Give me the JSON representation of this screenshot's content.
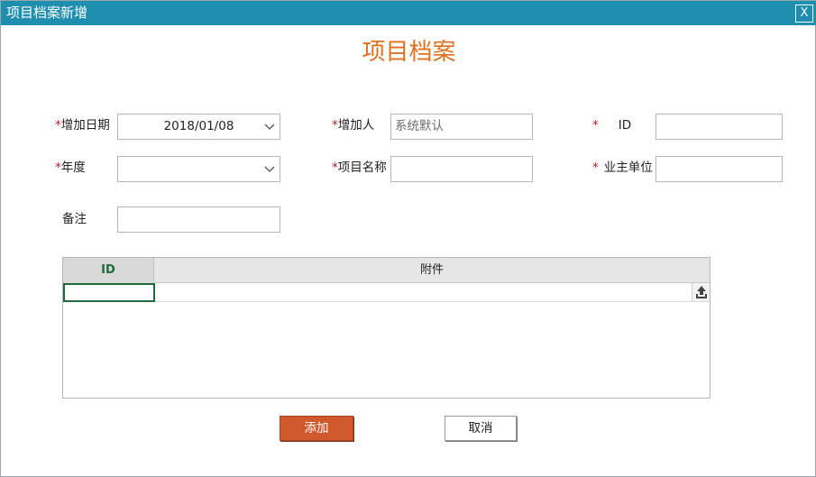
{
  "window": {
    "title": "项目档案新增",
    "close_label": "X"
  },
  "heading": "项目档案",
  "form": {
    "add_date": {
      "required_mark": "*",
      "label": "增加日期",
      "value": "2018/01/08"
    },
    "adder": {
      "required_mark": "*",
      "label": "增加人",
      "value": "系统默认"
    },
    "id": {
      "required_mark": "*",
      "label": "ID",
      "value": ""
    },
    "year": {
      "required_mark": "*",
      "label": "年度",
      "value": ""
    },
    "project_name": {
      "required_mark": "*",
      "label": "项目名称",
      "value": ""
    },
    "owner_unit": {
      "required_mark": "*",
      "label": "业主单位",
      "value": ""
    },
    "remark": {
      "label": "备注",
      "value": ""
    }
  },
  "grid": {
    "columns": [
      "ID",
      "附件"
    ],
    "rows": [
      {
        "id": "",
        "attachment": ""
      }
    ]
  },
  "buttons": {
    "add": "添加",
    "cancel": "取消"
  },
  "colors": {
    "titlebar": "#1e8fae",
    "heading": "#e0701e",
    "add_button": "#d05a2e",
    "required": "#c0141e",
    "id_header": "#1f6b3a"
  },
  "icons": {
    "chevron": "chevron-down-icon",
    "upload": "upload-icon",
    "close": "close-icon"
  }
}
